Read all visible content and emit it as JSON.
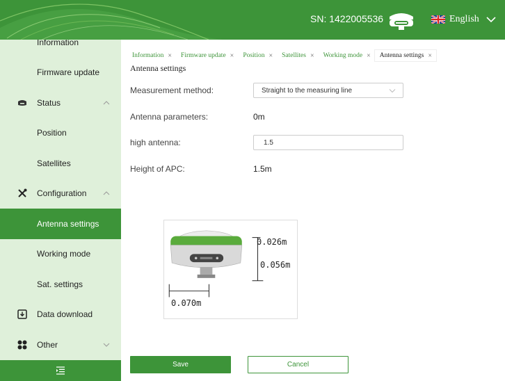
{
  "header": {
    "sn_text": "SN: 1422005536",
    "language": "English",
    "icons": {
      "receiver": "gnss-receiver-icon",
      "flag": "uk-flag-icon",
      "dropdown": "chevron-down-icon"
    }
  },
  "sidebar": {
    "items": [
      {
        "label": "Information",
        "active": false
      },
      {
        "label": "Firmware update",
        "active": false
      },
      {
        "label": "Status",
        "icon": "receiver-icon",
        "expandable": true
      },
      {
        "label": "Position",
        "active": false
      },
      {
        "label": "Satellites",
        "active": false
      },
      {
        "label": "Configuration",
        "icon": "tools-icon",
        "expandable": true
      },
      {
        "label": "Antenna settings",
        "active": true
      },
      {
        "label": "Working mode",
        "active": false
      },
      {
        "label": "Sat. settings",
        "active": false
      },
      {
        "label": "Data download",
        "icon": "download-icon"
      },
      {
        "label": "Other",
        "icon": "grid-icon",
        "expandable": true
      }
    ],
    "footer_icon": "collapse-menu-icon"
  },
  "tabs": [
    {
      "label": "Information",
      "close": "×"
    },
    {
      "label": "Firmware update",
      "close": "×"
    },
    {
      "label": "Position",
      "close": "×"
    },
    {
      "label": "Satellites",
      "close": "×"
    },
    {
      "label": "Working mode",
      "close": "×"
    },
    {
      "label": "Antenna settings",
      "close": "×",
      "active": true
    }
  ],
  "main": {
    "title": "Antenna settings",
    "measurement_method": {
      "label": "Measurement method:",
      "value": "Straight to the measuring line"
    },
    "antenna_parameters": {
      "label": "Antenna parameters:",
      "value": "0m"
    },
    "high_antenna": {
      "label": "high antenna:",
      "value": "1.5"
    },
    "height_apc": {
      "label": "Height of APC:",
      "value": "1.5m"
    },
    "diagram": {
      "dim_top": "0.026m",
      "dim_middle": "0.056m",
      "dim_bottom": "0.070m"
    },
    "save_label": "Save",
    "cancel_label": "Cancel"
  },
  "colors": {
    "brand_green": "#3d9439",
    "sidebar_bg": "#dff0da"
  }
}
